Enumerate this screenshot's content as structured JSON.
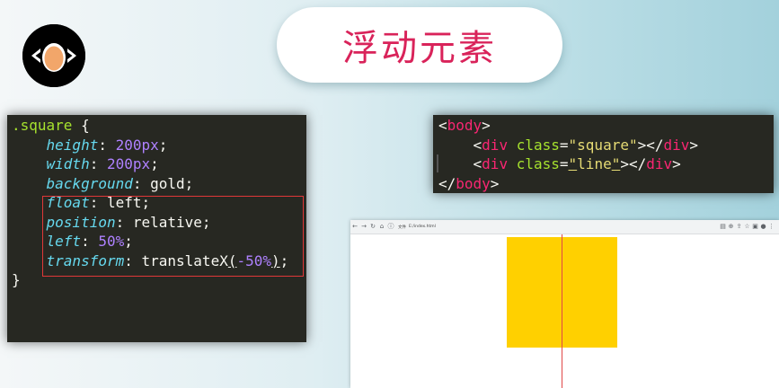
{
  "title": "浮动元素",
  "css_code": {
    "lines": [
      {
        "selector": ".square",
        "open": " {"
      },
      {
        "prop": "height",
        "val_num": "200",
        "val_unit": "px",
        "end": ";"
      },
      {
        "prop": "width",
        "val_num": "200",
        "val_unit": "px",
        "end": ";"
      },
      {
        "prop": "background",
        "val_plain": "gold",
        "end": ";"
      },
      {
        "prop": "float",
        "val_plain": "left",
        "end": ";"
      },
      {
        "prop": "position",
        "val_plain": "relative",
        "end": ";"
      },
      {
        "prop": "left",
        "val_num": "50",
        "val_unit": "%",
        "end": ";"
      },
      {
        "prop": "transform",
        "fn": "translateX",
        "paren_open": "(",
        "arg_num": "-50",
        "arg_unit": "%",
        "paren_close": ")",
        "end": ";"
      },
      {
        "close": "}"
      }
    ]
  },
  "html_code": {
    "lines": [
      {
        "lt": "<",
        "tag": "body",
        "gt": ">"
      },
      {
        "lt": "<",
        "tag": "div",
        "attr": "class",
        "eq": "=",
        "value": "\"square\"",
        "close_open": "></",
        "close_tag": "div",
        "gt": ">"
      },
      {
        "lt": "<",
        "tag": "div",
        "attr": "class",
        "eq": "=",
        "value_q1": "\"",
        "value_inner": "line",
        "value_q2": "\"",
        "close_open": "></",
        "close_tag": "div",
        "gt": ">"
      },
      {
        "lt": "</",
        "tag": "body",
        "gt": ">"
      }
    ]
  },
  "browser": {
    "url": "E:/index.html",
    "site_info": "文件",
    "icons": [
      "back-arrow-icon",
      "forward-arrow-icon",
      "reload-icon",
      "home-icon",
      "info-icon",
      "translate-icon",
      "zoom-icon",
      "share-icon",
      "star-icon",
      "extension-icon",
      "avatar",
      "menu-icon"
    ],
    "preview": {
      "square_color": "#ffd000",
      "line_color": "#e04848"
    }
  },
  "colors": {
    "title_color": "#d9235a",
    "code_bg": "#272822",
    "highlight_border": "#e03838"
  }
}
